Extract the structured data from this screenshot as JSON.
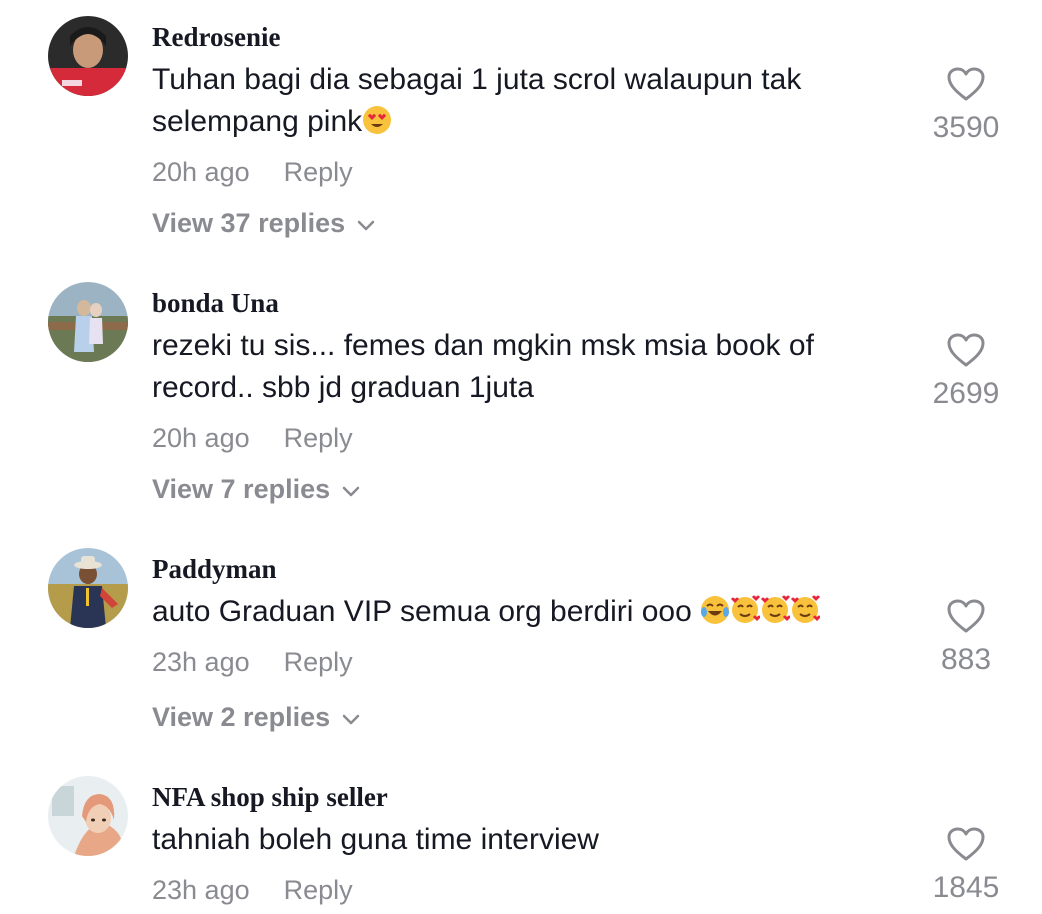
{
  "comments": [
    {
      "username": "Redrosenie",
      "text": "Tuhan bagi dia sebagai 1 juta scrol walaupun tak selempang pink",
      "emojis": [
        "heart-eyes"
      ],
      "time": "20h ago",
      "reply_label": "Reply",
      "view_replies": "View 37 replies",
      "likes": "3590"
    },
    {
      "username": "bonda Una",
      "text": "rezeki tu sis... femes dan mgkin msk msia book of record.. sbb jd graduan 1juta",
      "emojis": [],
      "time": "20h ago",
      "reply_label": "Reply",
      "view_replies": "View 7 replies",
      "likes": "2699"
    },
    {
      "username": "Paddyman",
      "text": "auto Graduan VIP semua org berdiri ooo ",
      "emojis": [
        "tears-of-joy",
        "smiling-with-hearts",
        "smiling-with-hearts",
        "smiling-with-hearts"
      ],
      "time": "23h ago",
      "reply_label": "Reply",
      "view_replies": "View 2 replies",
      "likes": "883"
    },
    {
      "username": "NFA shop ship seller",
      "text": "tahniah boleh guna time interview",
      "emojis": [],
      "time": "23h ago",
      "reply_label": "Reply",
      "likes": "1845"
    }
  ],
  "icons": {
    "like": "heart-outline-icon",
    "expand": "chevron-down-icon"
  },
  "colors": {
    "text": "#161823",
    "secondary": "#8a8b91",
    "background": "#ffffff"
  }
}
